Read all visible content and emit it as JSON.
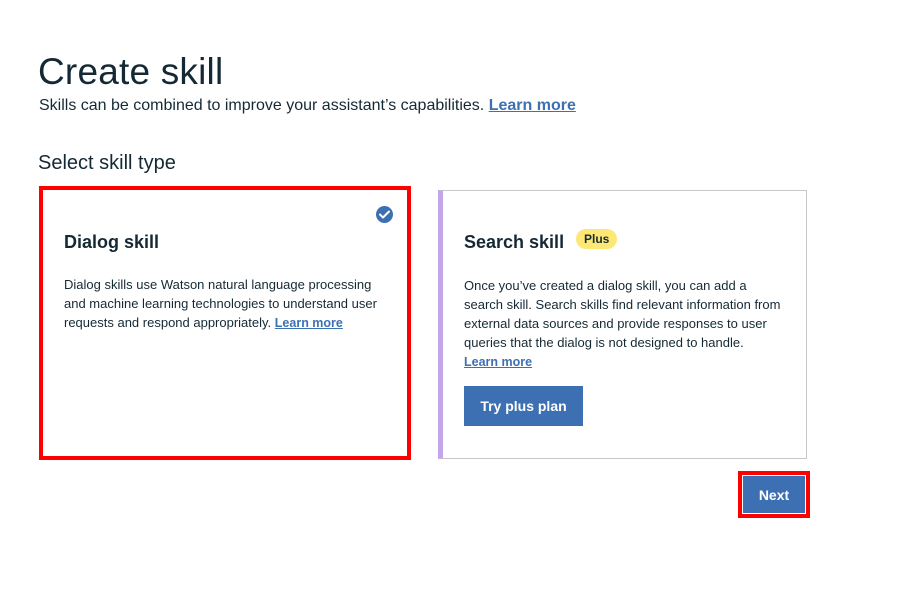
{
  "header": {
    "title": "Create skill",
    "subtitle": "Skills can be combined to improve your assistant’s capabilities.",
    "learn_more": "Learn more"
  },
  "section": {
    "label": "Select skill type"
  },
  "cards": {
    "dialog": {
      "title": "Dialog skill",
      "description": "Dialog skills use Watson natural language processing and machine learning technologies to understand user requests and respond appropriately.",
      "learn_more": "Learn more",
      "selected": true,
      "selected_icon": "checkmark-filled-icon"
    },
    "search": {
      "title": "Search skill",
      "badge": "Plus",
      "description": "Once you’ve created a dialog skill, you can add a search skill. Search skills find relevant information from external data sources and provide responses to user queries that the dialog is not designed to handle.",
      "learn_more": "Learn more",
      "button_label": "Try plus plan",
      "selected": false
    }
  },
  "footer": {
    "next_label": "Next"
  },
  "colors": {
    "primary": "#3d70b2",
    "text": "#152935",
    "badge": "#fde876",
    "accent_border": "#c3a6ea",
    "highlight": "#ff0000"
  }
}
